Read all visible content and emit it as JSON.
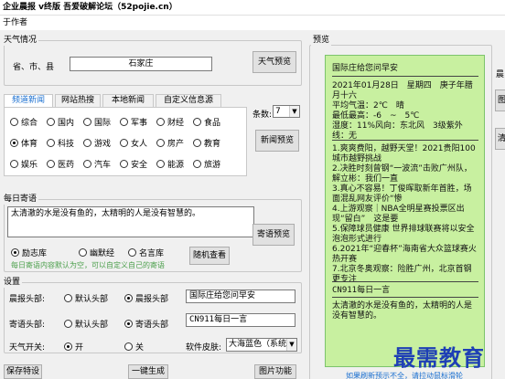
{
  "window": {
    "title": "企业晨报 v终版 吾爱破解论坛（52pojie.cn）"
  },
  "menu": {
    "author": "于作者"
  },
  "weather": {
    "group_label": "天气情况",
    "region_label": "省、市、县",
    "region_value": "石家庄",
    "preview_button": "天气预览"
  },
  "news": {
    "tabs": [
      "频道新闻",
      "网站热搜",
      "本地新闻",
      "自定义信息源"
    ],
    "active_tab": 0,
    "categories": [
      {
        "label": "综合",
        "selected": false
      },
      {
        "label": "国内",
        "selected": false
      },
      {
        "label": "国际",
        "selected": false
      },
      {
        "label": "军事",
        "selected": false
      },
      {
        "label": "财经",
        "selected": false
      },
      {
        "label": "食品",
        "selected": false
      },
      {
        "label": "体育",
        "selected": true
      },
      {
        "label": "科技",
        "selected": false
      },
      {
        "label": "游戏",
        "selected": false
      },
      {
        "label": "女人",
        "selected": false
      },
      {
        "label": "房产",
        "selected": false
      },
      {
        "label": "教育",
        "selected": false
      },
      {
        "label": "娱乐",
        "selected": false
      },
      {
        "label": "医药",
        "selected": false
      },
      {
        "label": "汽车",
        "selected": false
      },
      {
        "label": "安全",
        "selected": false
      },
      {
        "label": "能源",
        "selected": false
      },
      {
        "label": "旅游",
        "selected": false
      }
    ],
    "count_label": "条数:",
    "count_value": "7",
    "preview_button": "新闻预览"
  },
  "quote": {
    "group_label": "每日寄语",
    "text": "太清澈的水是没有鱼的，太精明的人是没有智慧的。",
    "sources": [
      {
        "label": "励志库",
        "selected": true
      },
      {
        "label": "幽默经",
        "selected": false
      },
      {
        "label": "名言库",
        "selected": false
      }
    ],
    "note": "每日寄语内容默认为空，可以自定义自己的寄语",
    "random_button": "随机查看",
    "preview_button": "寄语预览"
  },
  "settings": {
    "group_label": "设置",
    "morning_header_label": "晨报头部:",
    "morning_header_options": [
      {
        "label": "默认头部",
        "selected": false
      },
      {
        "label": "晨报头部",
        "selected": true
      }
    ],
    "morning_header_value": "国际庄给您问早安",
    "quote_header_label": "寄语头部:",
    "quote_header_options": [
      {
        "label": "默认头部",
        "selected": false
      },
      {
        "label": "寄语头部",
        "selected": true
      }
    ],
    "quote_header_value": "CN911每日一言",
    "weather_switch_label": "天气开关:",
    "weather_switch_options": [
      {
        "label": "开",
        "selected": true
      },
      {
        "label": "关",
        "selected": false
      }
    ],
    "skin_label": "软件皮肤:",
    "skin_value": "大海蓝色（系统"
  },
  "bottom_buttons": {
    "save": "保存特设",
    "generate": "一键生成",
    "image": "图片功能"
  },
  "preview": {
    "group_label": "预览",
    "title": "国际庄给您问早安",
    "weather_block": "2021年01月28日　星期四　庚子年腊月十六\n平均气温：2℃　晴\n最低最高：-6　~　5℃\n湿度：11%风向：东北风　3级紫外线：无",
    "news_block": "1.爽爽费阳，越野天堂！2021贵阳100城市越野挑战\n2.决胜时刻曾钢“一波流”击败广州队，解立彬：我们一直\n3.真心不容易！丁俊晖取新年首胜，场面混乱网友评价“惨\n4.上游观察｜NBA全明星赛投票区出现“留白”　这是要\n5.保障球员健康 世界排球联赛将以安全泡泡形式进行\n6.2021年“迎春杯”海南省大众篮球赛火热开赛\n7.北京冬奥观察：险胜广州，北京首钢更专注",
    "quote_header": "CN911每日一言",
    "quote_text": "太清澈的水是没有鱼的，太精明的人是没有智慧的。"
  },
  "side_buttons": {
    "b1": "晨",
    "b2": "图",
    "b3": "清"
  },
  "watermark": {
    "text": "最需教育"
  },
  "hint": {
    "text": "如果刷新预示不全，请拉动鼠标滑轮"
  }
}
